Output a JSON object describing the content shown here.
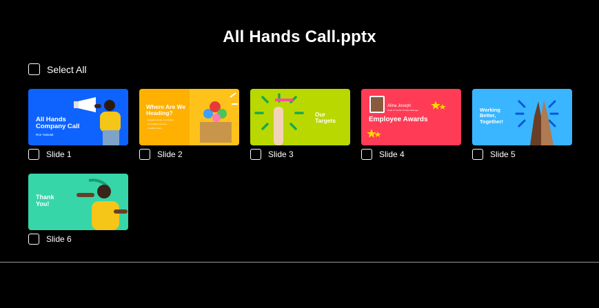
{
  "title": "All Hands Call.pptx",
  "select_all_label": "Select All",
  "colors": {
    "background": "#000000",
    "slide1": "#0e63ff",
    "slide2": "#ffb000",
    "slide3": "#b9d800",
    "slide4": "#ff3b55",
    "slide5": "#39b6ff",
    "slide6": "#36d6a8"
  },
  "slides": [
    {
      "label": "Slide 1",
      "thumb_title": "All Hands Company Call",
      "thumb_subtitle": "Ron Yatsutal",
      "icons": [
        "megaphone-icon",
        "person-photo"
      ]
    },
    {
      "label": "Slide 2",
      "thumb_title": "Where Are We Heading?",
      "thumb_bullets": [
        "Engaged people everywhere",
        "An invitation improve",
        "A healthy future"
      ],
      "icons": [
        "balloons-box-photo"
      ]
    },
    {
      "label": "Slide 3",
      "thumb_title": "Our Targets",
      "icons": [
        "dart-hand-photo"
      ]
    },
    {
      "label": "Slide 4",
      "thumb_name": "Alina Joseph",
      "thumb_role": "Head of Trends, Product Manager",
      "thumb_title": "Employee Awards",
      "icons": [
        "stars-icon"
      ]
    },
    {
      "label": "Slide 5",
      "thumb_title": "Working Better, Together!",
      "icons": [
        "high-five-photo"
      ]
    },
    {
      "label": "Slide 6",
      "thumb_title": "Thank You!",
      "icons": [
        "person-thumbs-photo"
      ]
    }
  ]
}
